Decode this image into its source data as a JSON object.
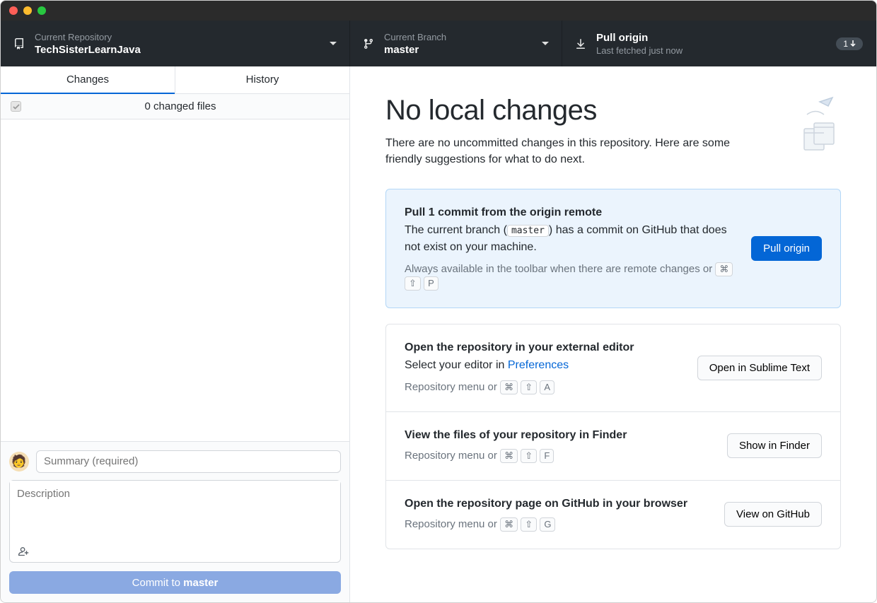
{
  "toolbar": {
    "repo": {
      "label": "Current Repository",
      "value": "TechSisterLearnJava"
    },
    "branch": {
      "label": "Current Branch",
      "value": "master"
    },
    "pull": {
      "label": "Pull origin",
      "sub": "Last fetched just now",
      "badge_count": "1"
    }
  },
  "tabs": {
    "changes": "Changes",
    "history": "History"
  },
  "changes": {
    "count_text": "0 changed files"
  },
  "commit": {
    "summary_placeholder": "Summary (required)",
    "desc_placeholder": "Description",
    "button_prefix": "Commit to ",
    "button_branch": "master"
  },
  "hero": {
    "title": "No local changes",
    "subtitle": "There are no uncommitted changes in this repository. Here are some friendly suggestions for what to do next."
  },
  "cards": {
    "pull": {
      "title": "Pull 1 commit from the origin remote",
      "desc_pre": "The current branch (",
      "desc_branch": "master",
      "desc_post": ") has a commit on GitHub that does not exist on your machine.",
      "hint_pre": "Always available in the toolbar when there are remote changes or ",
      "k1": "⌘",
      "k2": "⇧",
      "k3": "P",
      "button": "Pull origin"
    },
    "editor": {
      "title": "Open the repository in your external editor",
      "desc_pre": "Select your editor in ",
      "link": "Preferences",
      "hint_pre": "Repository menu or ",
      "k1": "⌘",
      "k2": "⇧",
      "k3": "A",
      "button": "Open in Sublime Text"
    },
    "finder": {
      "title": "View the files of your repository in Finder",
      "hint_pre": "Repository menu or ",
      "k1": "⌘",
      "k2": "⇧",
      "k3": "F",
      "button": "Show in Finder"
    },
    "github": {
      "title": "Open the repository page on GitHub in your browser",
      "hint_pre": "Repository menu or ",
      "k1": "⌘",
      "k2": "⇧",
      "k3": "G",
      "button": "View on GitHub"
    }
  }
}
